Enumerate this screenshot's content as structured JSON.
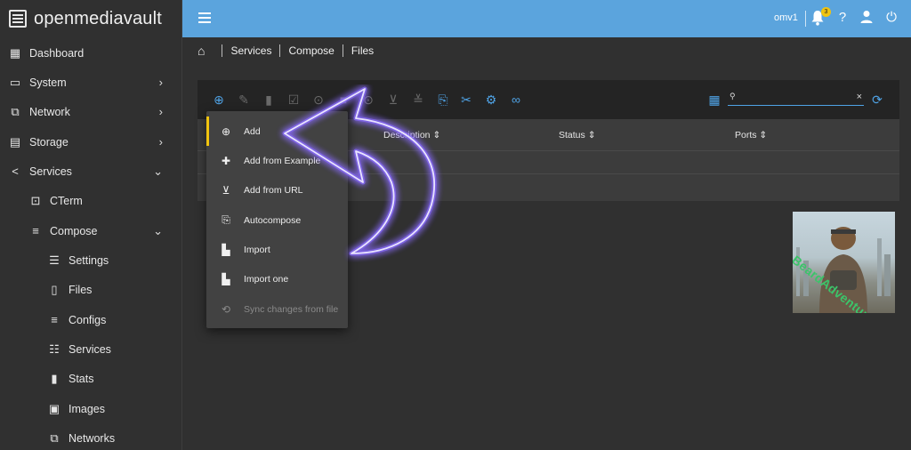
{
  "app": {
    "name": "openmediavault"
  },
  "topbar": {
    "hostname": "omv1",
    "notification_count": "3"
  },
  "sidebar": {
    "items": [
      {
        "label": "Dashboard",
        "icon": "grid-icon"
      },
      {
        "label": "System",
        "icon": "laptop-icon"
      },
      {
        "label": "Network",
        "icon": "network-icon"
      },
      {
        "label": "Storage",
        "icon": "storage-icon"
      },
      {
        "label": "Services",
        "icon": "share-icon"
      },
      {
        "label": "CTerm",
        "icon": "terminal-icon"
      },
      {
        "label": "Compose",
        "icon": "compose-icon"
      },
      {
        "label": "Settings",
        "icon": "sliders-icon"
      },
      {
        "label": "Files",
        "icon": "file-icon"
      },
      {
        "label": "Configs",
        "icon": "lines-icon"
      },
      {
        "label": "Services",
        "icon": "list-icon"
      },
      {
        "label": "Stats",
        "icon": "bar-chart-icon"
      },
      {
        "label": "Images",
        "icon": "image-icon"
      },
      {
        "label": "Networks",
        "icon": "network-icon"
      }
    ]
  },
  "breadcrumb": [
    "Services",
    "Compose",
    "Files"
  ],
  "table": {
    "columns": [
      {
        "label": "Description"
      },
      {
        "label": "Status"
      },
      {
        "label": "Ports"
      }
    ]
  },
  "search": {
    "value": ""
  },
  "menu": {
    "items": [
      {
        "label": "Add",
        "icon": "plus-circle-icon"
      },
      {
        "label": "Add from Example",
        "icon": "plus-box-icon"
      },
      {
        "label": "Add from URL",
        "icon": "download-box-icon"
      },
      {
        "label": "Autocompose",
        "icon": "file-plus-icon"
      },
      {
        "label": "Import",
        "icon": "file-import-icon"
      },
      {
        "label": "Import one",
        "icon": "file-import-one-icon"
      },
      {
        "label": "Sync changes from file",
        "icon": "file-sync-icon"
      }
    ]
  },
  "thumbnail": {
    "watermark": "BeardAdventures"
  },
  "colors": {
    "topbar": "#5ba4dd",
    "accent": "#4fa3e6",
    "active_marker": "#f1c40f"
  }
}
